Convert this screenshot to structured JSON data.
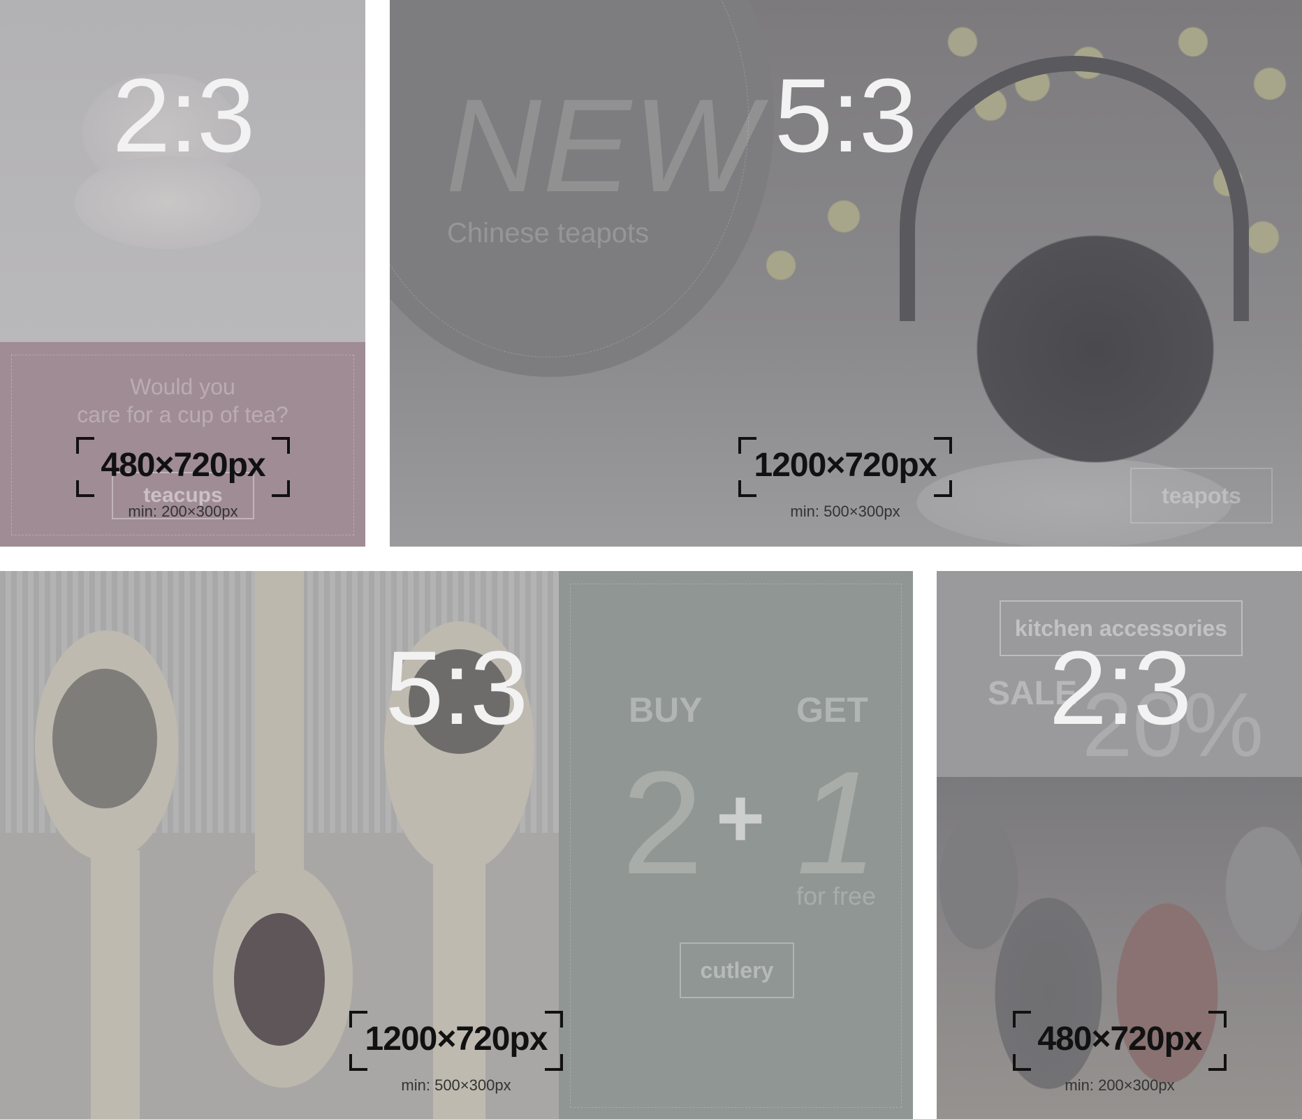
{
  "tiles": [
    {
      "ratio": "2:3",
      "size": "480×720px",
      "min": "min: 200×300px",
      "promo_line1": "Would you",
      "promo_line2": "care for a cup of tea?",
      "button": "teacups"
    },
    {
      "ratio": "5:3",
      "size": "1200×720px",
      "min": "min: 500×300px",
      "headline": "NEW",
      "subline": "Chinese teapots",
      "button": "teapots"
    },
    {
      "ratio": "5:3",
      "size": "1200×720px",
      "min": "min: 500×300px",
      "buy": "BUY",
      "get": "GET",
      "two": "2",
      "plus": "+",
      "one": "1",
      "for_free": "for free",
      "button": "cutlery"
    },
    {
      "ratio": "2:3",
      "size": "480×720px",
      "min": "min: 200×300px",
      "button": "kitchen accessories",
      "sale": "SALE",
      "percent": "20%"
    }
  ],
  "colors": {
    "tile1_top": "#b4b3b6",
    "tile1_bottom": "#a08c95",
    "tile2": "#8a898b",
    "tile3_left": "#b0afaf",
    "tile3_right": "#909693",
    "tile4_top": "#9a999c",
    "tile4_bottom": "#8a8789",
    "ratio_text": "#f2f2f2",
    "size_text": "#111111"
  }
}
